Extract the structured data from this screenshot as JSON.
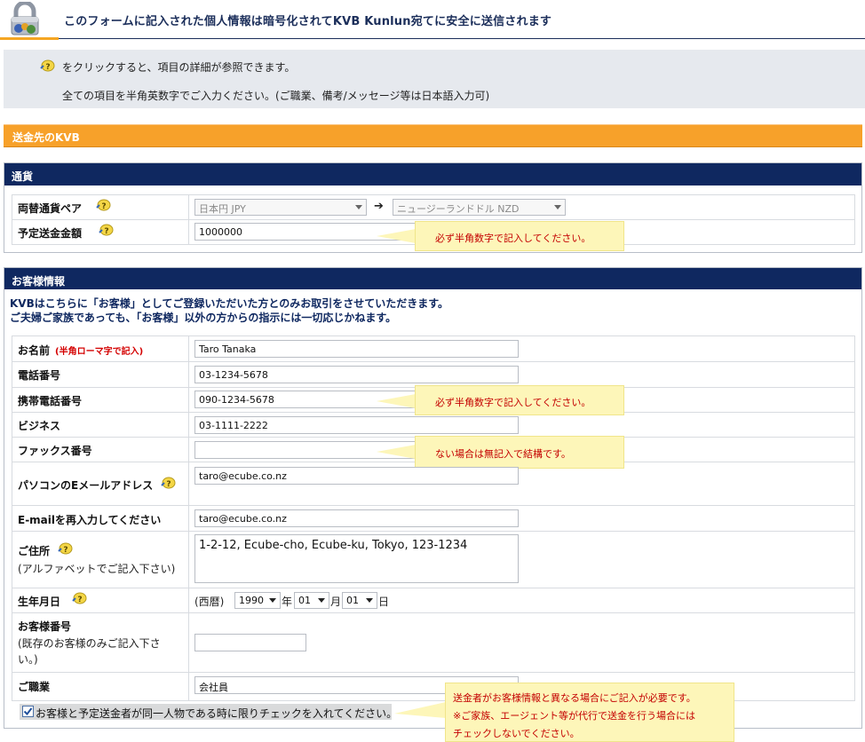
{
  "header": {
    "title": "このフォームに記入された個人情報は暗号化されてKVB Kunlun宛てに安全に送信されます"
  },
  "info": {
    "line1": "をクリックすると、項目の詳細が参照できます。",
    "line2": "全ての項目を半角英数字でご入力ください。(ご職業、備考/メッセージ等は日本語入力可)"
  },
  "recipient_bar": "送金先のKVB",
  "currency": {
    "title": "通貨",
    "pair_label": "両替通貨ペア",
    "from_currency": "日本円 JPY",
    "arrow": "➔",
    "to_currency": "ニュージーランドドル NZD",
    "amount_label": "予定送金金額",
    "amount_value": "1000000",
    "amount_tip": "必ず半角数字で記入してください。"
  },
  "customer": {
    "title": "お客様情報",
    "notice1": "KVBはこちらに「お客様」としてご登録いただいた方とのみお取引をさせていただきます。",
    "notice2": "ご夫婦ご家族であっても、「お客様」以外の方からの指示には一切応じかねます。",
    "name_label": "お名前",
    "name_note": "(半角ローマ字で記入)",
    "name_value": "Taro Tanaka",
    "phone_label": "電話番号",
    "phone_value": "03-1234-5678",
    "mobile_label": "携帯電話番号",
    "mobile_value": "090-1234-5678",
    "mobile_tip": "必ず半角数字で記入してください。",
    "business_label": "ビジネス",
    "business_value": "03-1111-2222",
    "fax_label": "ファックス番号",
    "fax_value": "",
    "fax_tip": "ない場合は無記入で結構です。",
    "email_label": "パソコンのEメールアドレス",
    "email_value": "taro@ecube.co.nz",
    "email2_label": "E-mailを再入力してください",
    "email2_value": "taro@ecube.co.nz",
    "address_label": "ご住所",
    "address_sub": "(アルファベットでご記入下さい)",
    "address_value": "1-2-12, Ecube-cho, Ecube-ku, Tokyo, 123-1234",
    "dob_label": "生年月日",
    "dob_era": "(西暦)",
    "dob_year": "1990",
    "dob_year_unit": "年",
    "dob_month": "01",
    "dob_month_unit": "月",
    "dob_day": "01",
    "dob_day_unit": "日",
    "custno_label": "お客様番号",
    "custno_sub1": "(既存のお客様のみご記入下さ",
    "custno_sub2": "い。)",
    "custno_value": "",
    "job_label": "ご職業",
    "job_value": "会社員",
    "same_person_check": "お客様と予定送金者が同一人物である時に限りチェックを入れてください。",
    "same_person_tip1": "送金者がお客様情報と異なる場合にご記入が必要です。",
    "same_person_tip2": "※ご家族、エージェント等が代行で送金を行う場合には",
    "same_person_tip3": "チェックしないでください。"
  },
  "colors": {
    "navy": "#0f2860",
    "orange": "#f7a12a",
    "tip_bg": "#fdf6b9",
    "tip_text": "#c40000"
  }
}
